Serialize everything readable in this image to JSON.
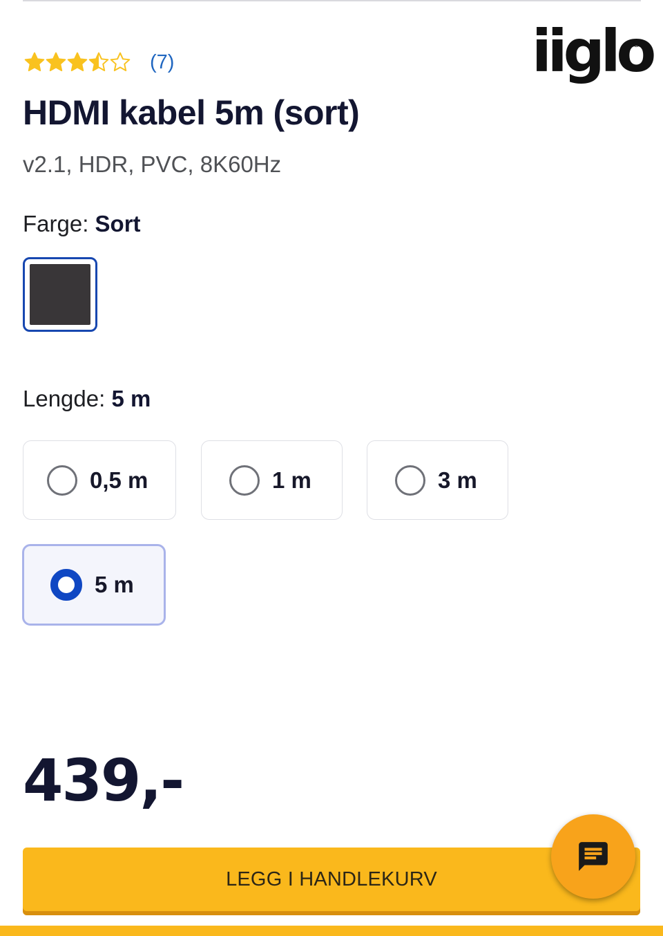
{
  "product": {
    "rating": 3.5,
    "rating_max": 5,
    "review_count": "(7)",
    "title": "HDMI kabel 5m (sort)",
    "subtitle": "v2.1, HDR, PVC, 8K60Hz",
    "price": "439,-"
  },
  "brand": {
    "logo_text": "iiglo",
    "logo_icon": "registered-mark"
  },
  "color": {
    "label": "Farge:",
    "selected": "Sort",
    "swatch_hex": "#393638",
    "accent": "#1747b0"
  },
  "length": {
    "label": "Lengde:",
    "selected": "5 m",
    "options": [
      {
        "label": "0,5 m",
        "selected": false
      },
      {
        "label": "1 m",
        "selected": false
      },
      {
        "label": "3 m",
        "selected": false
      },
      {
        "label": "5 m",
        "selected": true
      }
    ]
  },
  "actions": {
    "add_to_cart": "LEGG I HANDLEKURV",
    "chat_icon": "chat-icon",
    "button_color": "#fab81c"
  },
  "colors": {
    "star": "#f9c21f",
    "link": "#1f66c0",
    "radio_selected": "#0f47c3",
    "chat_fab": "#f8a31b"
  }
}
